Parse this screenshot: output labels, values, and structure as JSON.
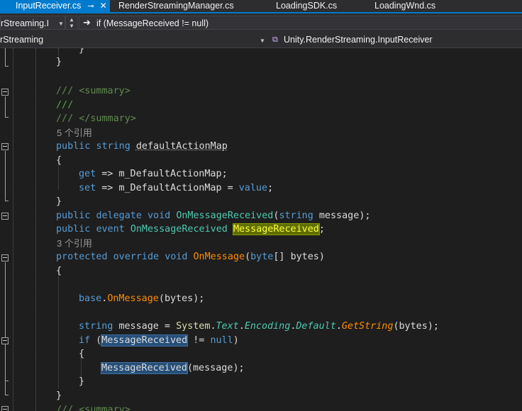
{
  "tabs": [
    {
      "label": "InputReceiver.cs",
      "active": true
    },
    {
      "label": "RenderStreamingManager.cs"
    },
    {
      "label": "LoadingSDK.cs"
    },
    {
      "label": "LoadingWnd.cs"
    }
  ],
  "tab_icons": {
    "pin": "⊸",
    "close": "✕"
  },
  "nav": {
    "project": "rStreaming.I",
    "member": "if (MessageReceived != null)",
    "scope": "rStreaming",
    "class_path": "Unity.RenderStreaming.InputReceiver"
  },
  "code": {
    "lens_5": "5 个引用",
    "lens_3": "3 个引用",
    "summary_open": "<summary>",
    "summary_close": "</summary>",
    "comment_prefix": "///",
    "kw_public": "public",
    "kw_string": "string",
    "kw_get": "get",
    "kw_set": "set",
    "kw_delegate": "delegate",
    "kw_void": "void",
    "kw_event": "event",
    "kw_protected": "protected",
    "kw_override": "override",
    "kw_byte": "byte",
    "kw_base": "base",
    "kw_if": "if",
    "kw_null": "null",
    "prop_default_action_map": "defaultActionMap",
    "field_default_action_map": "m_DefaultActionMap",
    "kw_value": "value",
    "delegate_type": "OnMessageReceived",
    "param_message": "message",
    "event_name": "MessageReceived",
    "method_on_message": "OnMessage",
    "param_bytes": "bytes",
    "ns_system": "System",
    "ns_text": "Text",
    "type_encoding": "Encoding",
    "prop_default": "Default",
    "method_get_string": "GetString"
  }
}
